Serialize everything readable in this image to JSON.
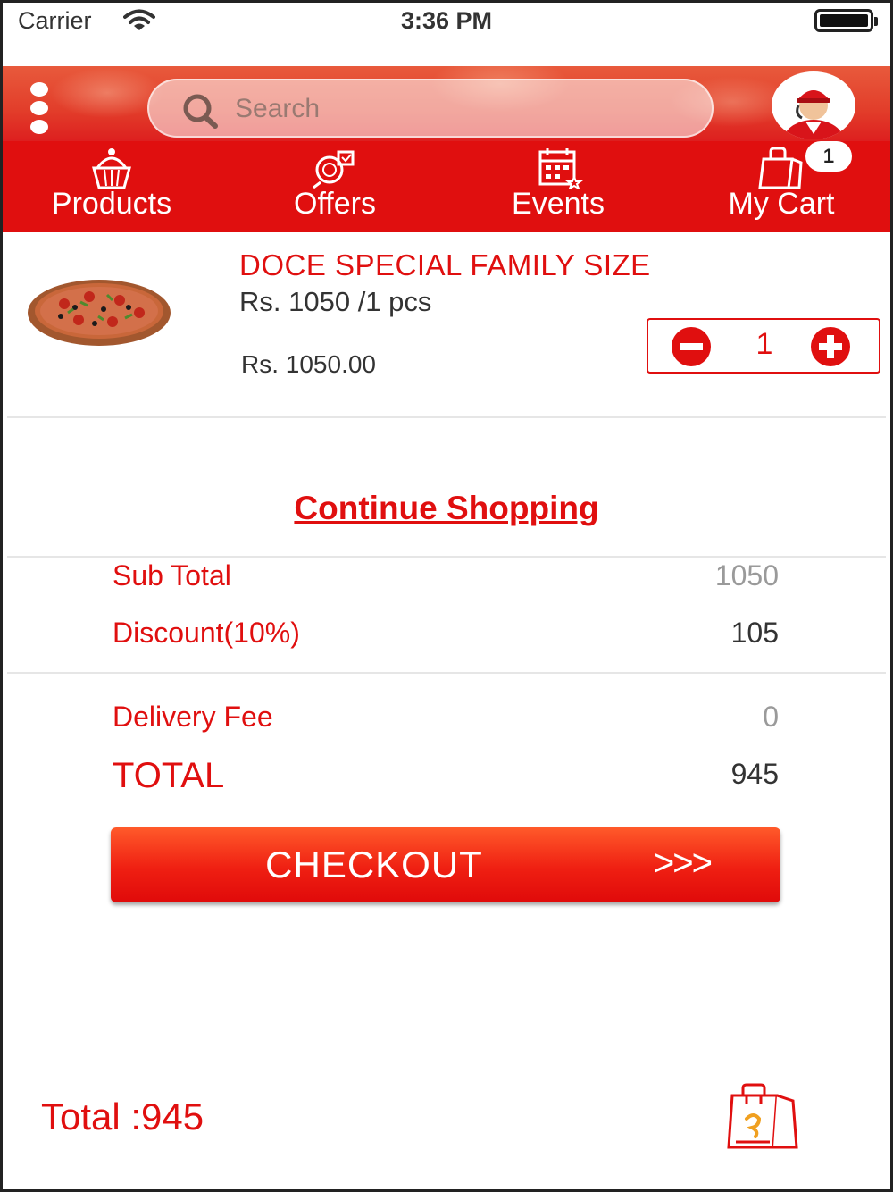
{
  "status_bar": {
    "carrier": "Carrier",
    "time": "3:36 PM"
  },
  "header": {
    "search_placeholder": "Search",
    "menu_icon": "more-vertical-icon",
    "avatar_icon": "delivery-person-avatar"
  },
  "nav": {
    "items": [
      {
        "label": "Products",
        "icon": "cupcake-icon"
      },
      {
        "label": "Offers",
        "icon": "offers-tag-icon"
      },
      {
        "label": "Events",
        "icon": "calendar-icon"
      },
      {
        "label": "My Cart",
        "icon": "shopping-bag-icon"
      }
    ],
    "cart_count": "1"
  },
  "cart": {
    "items": [
      {
        "name": "DOCE SPECIAL FAMILY SIZE",
        "unit_price": "Rs. 1050 /1 pcs",
        "line_total": "Rs. 1050.00",
        "quantity": "1",
        "image": "pizza"
      }
    ],
    "continue_label": "Continue Shopping"
  },
  "summary": {
    "sub_total_label": "Sub Total",
    "sub_total": "1050",
    "discount_label": "Discount(10%)",
    "discount": "105",
    "delivery_label": "Delivery Fee",
    "delivery": "0",
    "total_label": "TOTAL",
    "total": "945"
  },
  "checkout": {
    "label": "CHECKOUT",
    "arrows": ">>>"
  },
  "footer": {
    "total_text": "Total :945",
    "bag_icon": "shopping-bag-icon"
  },
  "colors": {
    "primary": "#e00f0f",
    "text": "#333333",
    "muted": "#9a9a9a"
  }
}
